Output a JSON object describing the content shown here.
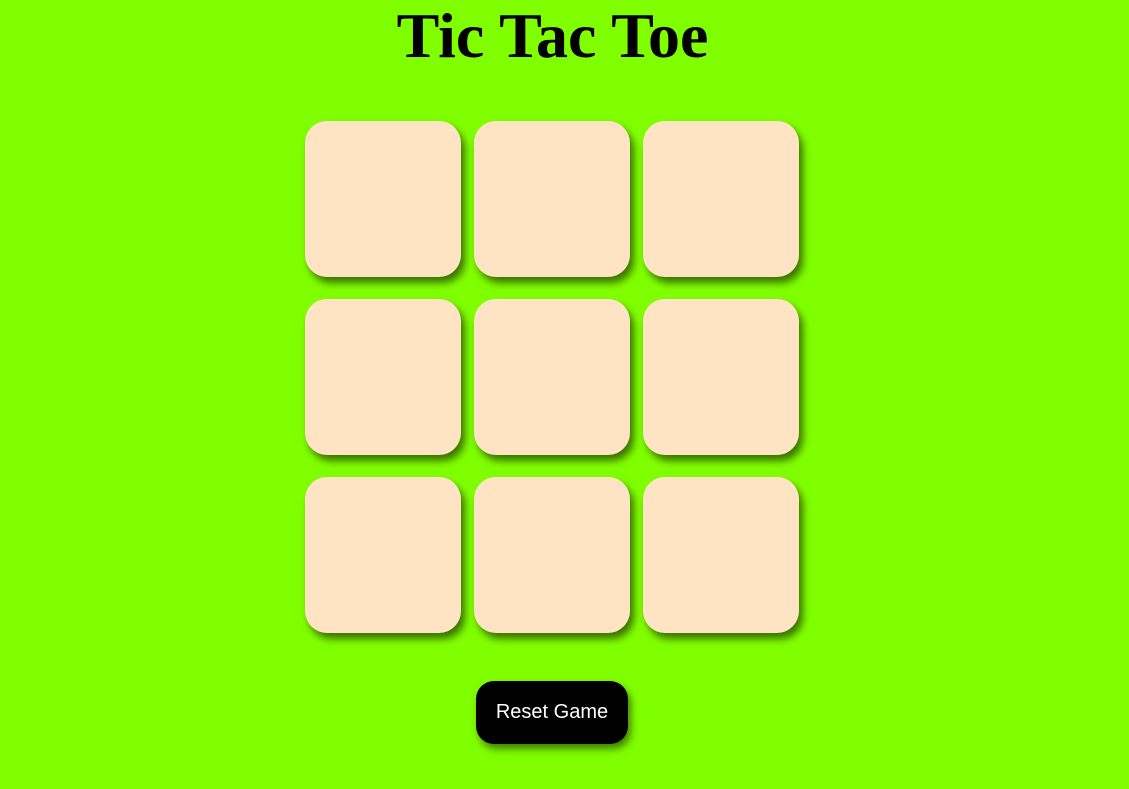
{
  "title": "Tic Tac Toe",
  "board": {
    "cells": [
      "",
      "",
      "",
      "",
      "",
      "",
      "",
      "",
      ""
    ]
  },
  "reset_label": "Reset Game",
  "colors": {
    "background": "#80ff00",
    "cell": "#ffe4c4",
    "button": "#000000",
    "button_text": "#ffffff"
  }
}
